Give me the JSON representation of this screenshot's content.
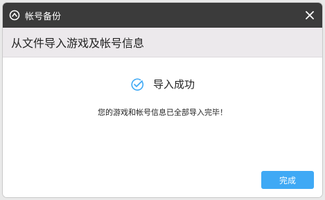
{
  "window": {
    "title": "帐号备份",
    "app_icon": "refresh-logo-icon",
    "close_icon": "close-icon"
  },
  "header": {
    "title": "从文件导入游戏及帐号信息"
  },
  "status": {
    "icon": "check-circle-icon",
    "text": "导入成功",
    "message": "您的游戏和帐号信息已全部导入完毕！"
  },
  "actions": {
    "done_label": "完成"
  },
  "colors": {
    "titlebar": "#3b3b3b",
    "subheader": "#ece9ec",
    "accent": "#3fa9f5"
  }
}
